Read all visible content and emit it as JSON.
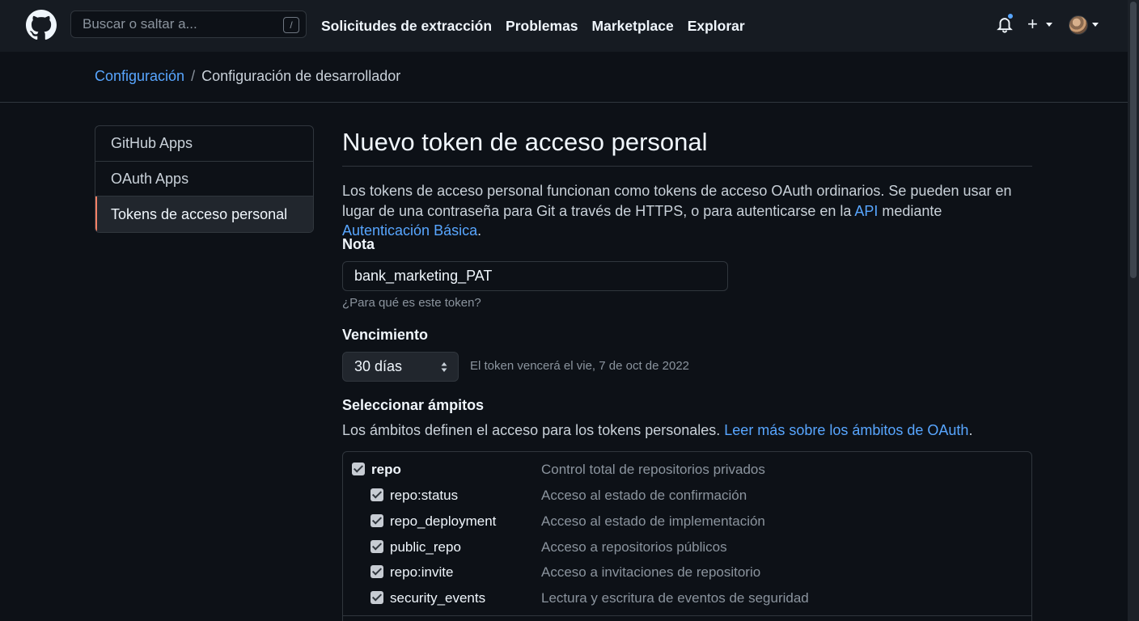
{
  "header": {
    "search_placeholder": "Buscar o saltar a...",
    "search_shortcut": "/",
    "nav": [
      "Solicitudes de extracción",
      "Problemas",
      "Marketplace",
      "Explorar"
    ],
    "plus_symbol": "+",
    "icons": [
      "github-logo-icon",
      "bell-icon",
      "plus-icon",
      "avatar"
    ]
  },
  "breadcrumb": {
    "parent": "Configuración",
    "separator": "/",
    "current": "Configuración de desarrollador"
  },
  "sidebar": {
    "items": [
      {
        "label": "GitHub Apps",
        "active": false
      },
      {
        "label": "OAuth Apps",
        "active": false
      },
      {
        "label": "Tokens de acceso personal",
        "active": true
      }
    ]
  },
  "main": {
    "title": "Nuevo token de acceso personal",
    "intro_part1": "Los tokens de acceso personal funcionan como tokens de acceso OAuth ordinarios. Se pueden usar en lugar de una contraseña para Git a través de HTTPS, o para autenticarse en la ",
    "intro_link_api": "API",
    "intro_part2": " mediante ",
    "intro_link_auth": "Autenticación Básica",
    "intro_part3": ".",
    "note_label": "Nota",
    "note_value": "bank_marketing_PAT",
    "note_hint": "¿Para qué es este token?",
    "expiration_label": "Vencimiento",
    "expiration_value": "30 días",
    "expiration_hint": "El token vencerá el vie, 7 de oct de 2022",
    "scopes_label": "Seleccionar ámpitos",
    "scopes_desc_part1": "Los ámbitos definen el acceso para los tokens personales. ",
    "scopes_desc_link": "Leer más sobre los ámbitos de OAuth",
    "scopes_desc_part2": "."
  },
  "scopes": [
    {
      "name": "repo",
      "description": "Control total de repositorios privados",
      "checked": true,
      "child": false
    },
    {
      "name": "repo:status",
      "description": "Acceso al estado de confirmación",
      "checked": true,
      "child": true
    },
    {
      "name": "repo_deployment",
      "description": "Acceso al estado de implementación",
      "checked": true,
      "child": true
    },
    {
      "name": "public_repo",
      "description": "Acceso a repositorios públicos",
      "checked": true,
      "child": true
    },
    {
      "name": "repo:invite",
      "description": "Acceso a invitaciones de repositorio",
      "checked": true,
      "child": true
    },
    {
      "name": "security_events",
      "description": "Lectura y escritura de eventos de seguridad",
      "checked": true,
      "child": true
    }
  ],
  "colors": {
    "background": "#0d1117",
    "header": "#161b22",
    "link": "#58a6ff",
    "active_marker": "#f78166"
  }
}
